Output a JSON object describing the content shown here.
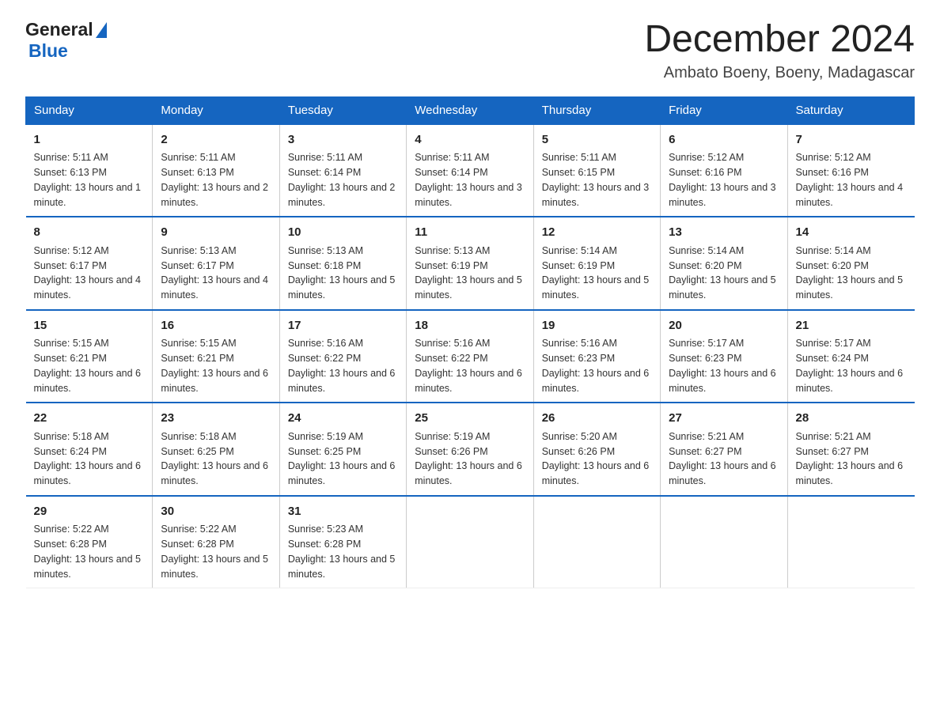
{
  "header": {
    "logo_general": "General",
    "logo_blue": "Blue",
    "month_title": "December 2024",
    "location": "Ambato Boeny, Boeny, Madagascar"
  },
  "weekdays": [
    "Sunday",
    "Monday",
    "Tuesday",
    "Wednesday",
    "Thursday",
    "Friday",
    "Saturday"
  ],
  "weeks": [
    [
      {
        "day": "1",
        "sunrise": "5:11 AM",
        "sunset": "6:13 PM",
        "daylight": "13 hours and 1 minute."
      },
      {
        "day": "2",
        "sunrise": "5:11 AM",
        "sunset": "6:13 PM",
        "daylight": "13 hours and 2 minutes."
      },
      {
        "day": "3",
        "sunrise": "5:11 AM",
        "sunset": "6:14 PM",
        "daylight": "13 hours and 2 minutes."
      },
      {
        "day": "4",
        "sunrise": "5:11 AM",
        "sunset": "6:14 PM",
        "daylight": "13 hours and 3 minutes."
      },
      {
        "day": "5",
        "sunrise": "5:11 AM",
        "sunset": "6:15 PM",
        "daylight": "13 hours and 3 minutes."
      },
      {
        "day": "6",
        "sunrise": "5:12 AM",
        "sunset": "6:16 PM",
        "daylight": "13 hours and 3 minutes."
      },
      {
        "day": "7",
        "sunrise": "5:12 AM",
        "sunset": "6:16 PM",
        "daylight": "13 hours and 4 minutes."
      }
    ],
    [
      {
        "day": "8",
        "sunrise": "5:12 AM",
        "sunset": "6:17 PM",
        "daylight": "13 hours and 4 minutes."
      },
      {
        "day": "9",
        "sunrise": "5:13 AM",
        "sunset": "6:17 PM",
        "daylight": "13 hours and 4 minutes."
      },
      {
        "day": "10",
        "sunrise": "5:13 AM",
        "sunset": "6:18 PM",
        "daylight": "13 hours and 5 minutes."
      },
      {
        "day": "11",
        "sunrise": "5:13 AM",
        "sunset": "6:19 PM",
        "daylight": "13 hours and 5 minutes."
      },
      {
        "day": "12",
        "sunrise": "5:14 AM",
        "sunset": "6:19 PM",
        "daylight": "13 hours and 5 minutes."
      },
      {
        "day": "13",
        "sunrise": "5:14 AM",
        "sunset": "6:20 PM",
        "daylight": "13 hours and 5 minutes."
      },
      {
        "day": "14",
        "sunrise": "5:14 AM",
        "sunset": "6:20 PM",
        "daylight": "13 hours and 5 minutes."
      }
    ],
    [
      {
        "day": "15",
        "sunrise": "5:15 AM",
        "sunset": "6:21 PM",
        "daylight": "13 hours and 6 minutes."
      },
      {
        "day": "16",
        "sunrise": "5:15 AM",
        "sunset": "6:21 PM",
        "daylight": "13 hours and 6 minutes."
      },
      {
        "day": "17",
        "sunrise": "5:16 AM",
        "sunset": "6:22 PM",
        "daylight": "13 hours and 6 minutes."
      },
      {
        "day": "18",
        "sunrise": "5:16 AM",
        "sunset": "6:22 PM",
        "daylight": "13 hours and 6 minutes."
      },
      {
        "day": "19",
        "sunrise": "5:16 AM",
        "sunset": "6:23 PM",
        "daylight": "13 hours and 6 minutes."
      },
      {
        "day": "20",
        "sunrise": "5:17 AM",
        "sunset": "6:23 PM",
        "daylight": "13 hours and 6 minutes."
      },
      {
        "day": "21",
        "sunrise": "5:17 AM",
        "sunset": "6:24 PM",
        "daylight": "13 hours and 6 minutes."
      }
    ],
    [
      {
        "day": "22",
        "sunrise": "5:18 AM",
        "sunset": "6:24 PM",
        "daylight": "13 hours and 6 minutes."
      },
      {
        "day": "23",
        "sunrise": "5:18 AM",
        "sunset": "6:25 PM",
        "daylight": "13 hours and 6 minutes."
      },
      {
        "day": "24",
        "sunrise": "5:19 AM",
        "sunset": "6:25 PM",
        "daylight": "13 hours and 6 minutes."
      },
      {
        "day": "25",
        "sunrise": "5:19 AM",
        "sunset": "6:26 PM",
        "daylight": "13 hours and 6 minutes."
      },
      {
        "day": "26",
        "sunrise": "5:20 AM",
        "sunset": "6:26 PM",
        "daylight": "13 hours and 6 minutes."
      },
      {
        "day": "27",
        "sunrise": "5:21 AM",
        "sunset": "6:27 PM",
        "daylight": "13 hours and 6 minutes."
      },
      {
        "day": "28",
        "sunrise": "5:21 AM",
        "sunset": "6:27 PM",
        "daylight": "13 hours and 6 minutes."
      }
    ],
    [
      {
        "day": "29",
        "sunrise": "5:22 AM",
        "sunset": "6:28 PM",
        "daylight": "13 hours and 5 minutes."
      },
      {
        "day": "30",
        "sunrise": "5:22 AM",
        "sunset": "6:28 PM",
        "daylight": "13 hours and 5 minutes."
      },
      {
        "day": "31",
        "sunrise": "5:23 AM",
        "sunset": "6:28 PM",
        "daylight": "13 hours and 5 minutes."
      },
      {
        "day": "",
        "sunrise": "",
        "sunset": "",
        "daylight": ""
      },
      {
        "day": "",
        "sunrise": "",
        "sunset": "",
        "daylight": ""
      },
      {
        "day": "",
        "sunrise": "",
        "sunset": "",
        "daylight": ""
      },
      {
        "day": "",
        "sunrise": "",
        "sunset": "",
        "daylight": ""
      }
    ]
  ],
  "labels": {
    "sunrise": "Sunrise:",
    "sunset": "Sunset:",
    "daylight": "Daylight:"
  }
}
